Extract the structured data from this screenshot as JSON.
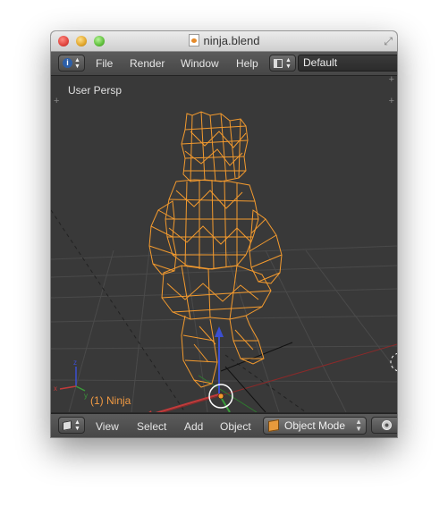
{
  "window": {
    "title": "ninja.blend"
  },
  "header": {
    "menu": [
      "File",
      "Render",
      "Window",
      "Help"
    ],
    "layout": "Default"
  },
  "viewport": {
    "view_label": "User Persp",
    "object_label": "(1) Ninja",
    "axis_labels": {
      "x": "x",
      "y": "y",
      "z": "z"
    }
  },
  "footer": {
    "menu": [
      "View",
      "Select",
      "Add",
      "Object"
    ],
    "mode": "Object Mode"
  },
  "colors": {
    "wireframe": "#f39a2e",
    "grid": "#4c4c4c",
    "x_axis": "#b13c3c",
    "y_axis": "#3a9a3a",
    "z_axis": "#3b4fd0",
    "label": "#f09a43"
  },
  "icons": [
    "info-icon",
    "screen-layout-icon",
    "editor-type-icon",
    "object-mode-icon",
    "manipulator-icon"
  ]
}
